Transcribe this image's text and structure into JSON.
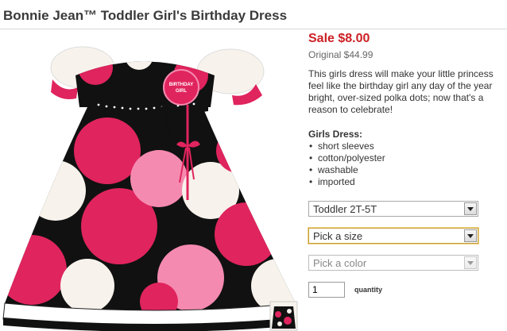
{
  "product": {
    "title": "Bonnie Jean™ Toddler Girl's Birthday Dress",
    "sale_price": "Sale $8.00",
    "original_price": "Original $44.99",
    "description": "This girls dress will make your little princess feel like the birthday girl any day of the year bright, over-sized polka dots; now that's a reason to celebrate!",
    "features_heading": "Girls Dress:",
    "features": [
      "short sleeves",
      "cotton/polyester",
      "washable",
      "imported"
    ],
    "badge_line1": "BIRTHDAY",
    "badge_line2": "GIRL"
  },
  "options": {
    "size_range": "Toddler 2T-5T",
    "size_placeholder": "Pick a size",
    "color_placeholder": "Pick a color"
  },
  "quantity": {
    "value": "1",
    "label": "quantity"
  },
  "colors": {
    "sale_red": "#cc1f24",
    "dress_pink": "#e0245e",
    "dress_black": "#111111",
    "dot_light_pink": "#f58ab0",
    "dot_cream": "#f7f3ec"
  }
}
